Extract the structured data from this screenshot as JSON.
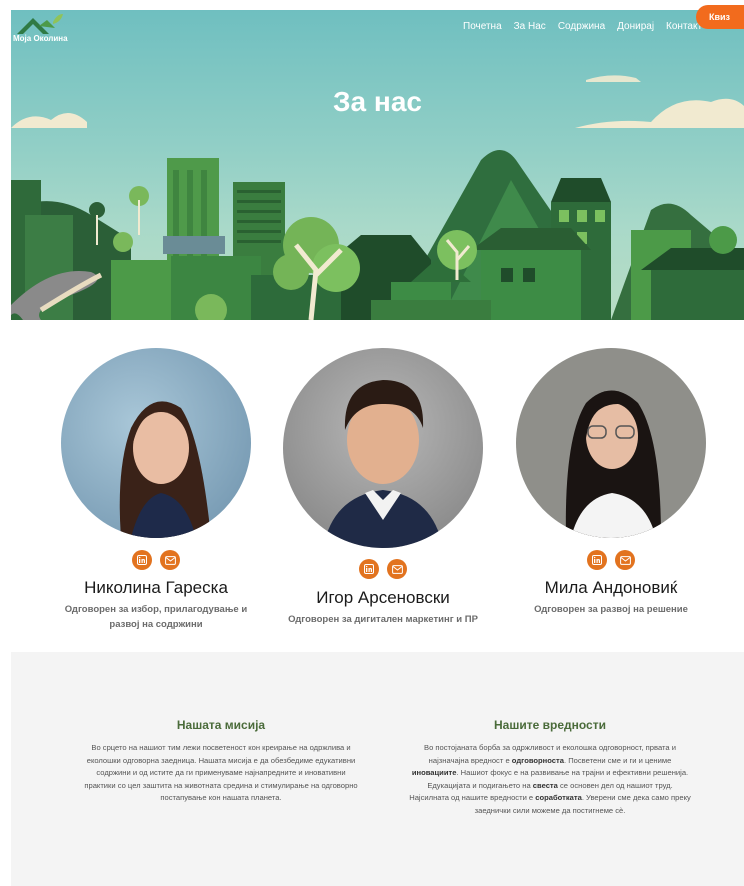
{
  "header": {
    "logo_text": "Моја Околина",
    "nav": [
      "Почетна",
      "За Нас",
      "Содржина",
      "Донирај",
      "Контакт"
    ],
    "quiz_label": "Квиз"
  },
  "hero": {
    "title": "За нас"
  },
  "team": [
    {
      "name": "Николина Гареска",
      "role_line1": "Одговорен за избор, прилагодување и",
      "role_line2": "развој на содржини"
    },
    {
      "name": "Игор Арсеновски",
      "role_line1": "Одговорен за дигитален маркетинг и ПР",
      "role_line2": ""
    },
    {
      "name": "Мила Андоновиќ",
      "role_line1": "Одговорен за развој на решение",
      "role_line2": ""
    }
  ],
  "mission": {
    "title": "Нашата мисија",
    "lines": [
      "Во срцето на нашиот тим лежи посветеност кон креирање на одржлива и",
      "еколошки одговорна заедница. Нашата мисија е да обезбедиме едукативни",
      "содржини и од истите да ги применуваме најнапредните и иновативни",
      "практики со цел заштита на животната средина и стимулирање на одговорно",
      "постапување кон нашата планета."
    ]
  },
  "values": {
    "title": "Нашите вредности",
    "l1": "Во постојаната борба за одржливост и еколошка одговорност, првата и",
    "l2a": "најзначајна вредност е ",
    "l2b": "одговорноста",
    "l2c": ". Посветени сме и ги и цениме",
    "l3a": "иновациите",
    "l3b": ". Нашиот фокус е на развивање на трајни и ефективни решенија.",
    "l4a": "Едукацијата и подигањето на ",
    "l4b": "свеста",
    "l4c": " се основен дел од нашиот труд.",
    "l5a": "Најсилната од нашите вредности е ",
    "l5b": "соработката",
    "l5c": ". Уверени сме дека само преку",
    "l6": "заеднички сили можеме да постигнеме сè."
  },
  "colors": {
    "accent": "#e2731f",
    "green": "#4a6b3a",
    "quiz": "#f26b1d"
  },
  "icons": {
    "social1": "linkedin-icon",
    "social2": "mail-icon"
  }
}
